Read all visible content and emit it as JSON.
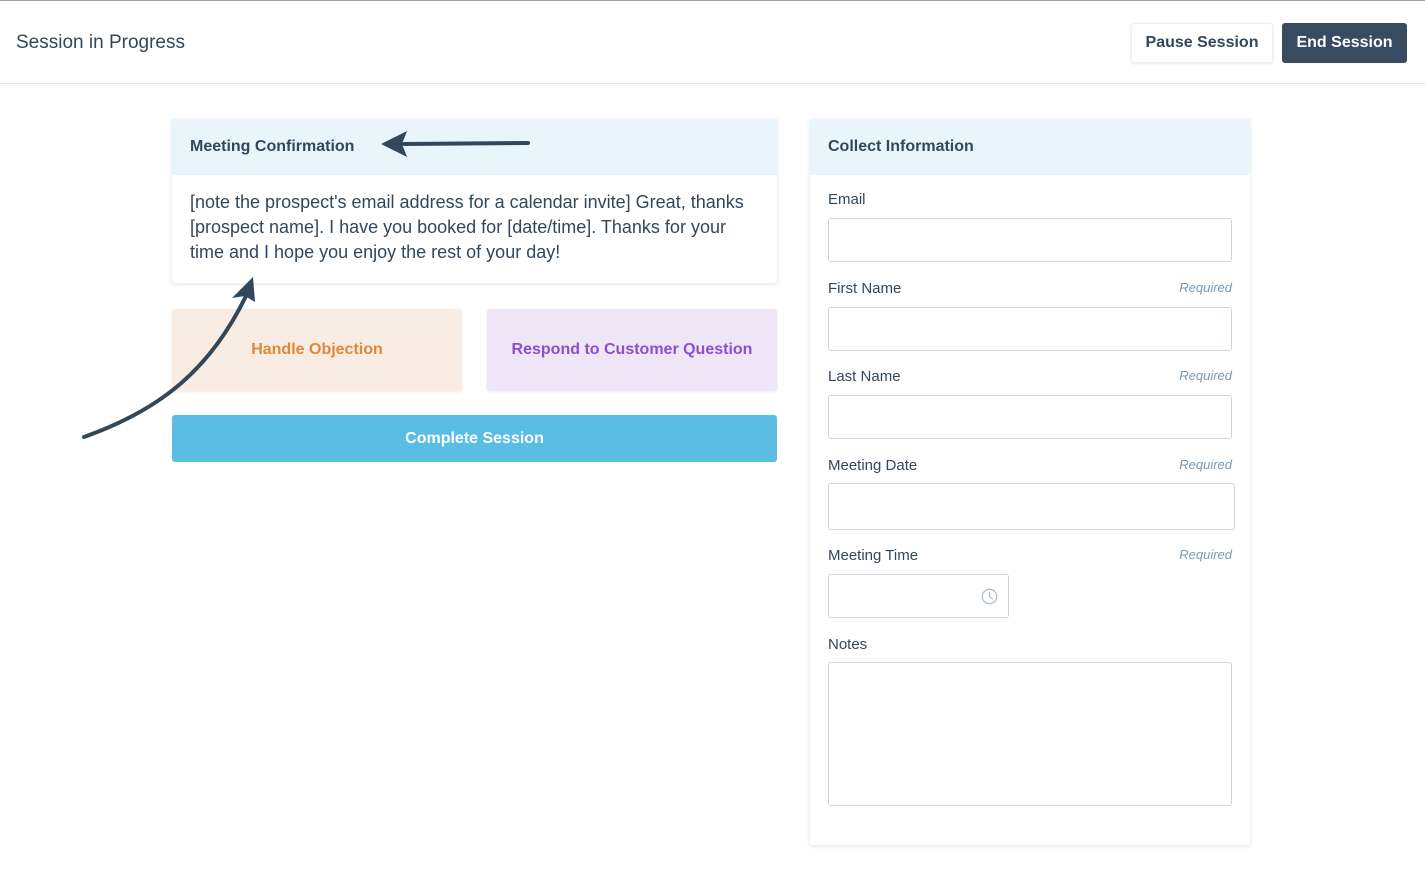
{
  "header": {
    "title": "Session in Progress",
    "pause_label": "Pause Session",
    "end_label": "End Session"
  },
  "script_card": {
    "title": "Meeting Confirmation",
    "body": "[note the prospect's email address for a calendar invite] Great, thanks [prospect name]. I have you booked for [date/time]. Thanks for your time and I hope you enjoy the rest of your day!"
  },
  "actions": {
    "objection_label": "Handle Objection",
    "question_label": "Respond to Customer Question",
    "complete_label": "Complete Session"
  },
  "info_card": {
    "title": "Collect Information",
    "fields": [
      {
        "label": "Email",
        "required": "",
        "value": ""
      },
      {
        "label": "First Name",
        "required": "Required",
        "value": ""
      },
      {
        "label": "Last Name",
        "required": "Required",
        "value": ""
      },
      {
        "label": "Meeting Date",
        "required": "Required",
        "value": ""
      },
      {
        "label": "Meeting Time",
        "required": "Required",
        "value": ""
      },
      {
        "label": "Notes",
        "required": "",
        "value": ""
      }
    ]
  },
  "icons": {
    "time_field": "clock-icon"
  },
  "colors": {
    "primary_dark": "#394b61",
    "complete_button": "#5bbde3",
    "objection_bg": "#f9ede3",
    "objection_text": "#e0883a",
    "question_bg": "#eee6f6",
    "question_text": "#8c4fd0",
    "card_header_bg": "#e8f5fb",
    "annotation_arrow": "#33475b"
  }
}
